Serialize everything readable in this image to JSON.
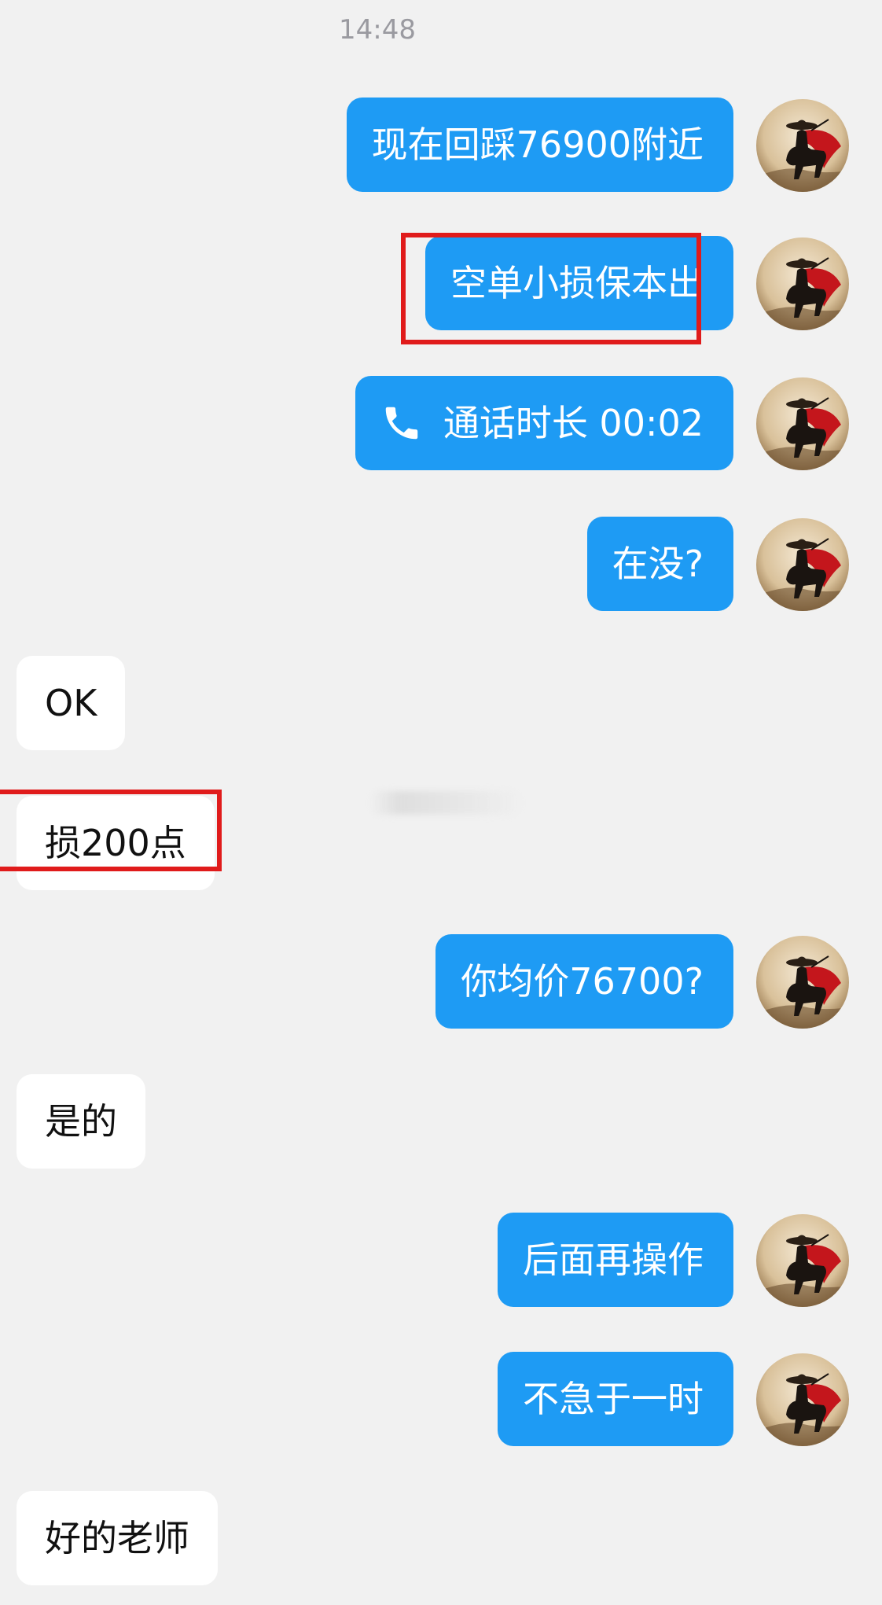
{
  "timestamp": "14:48",
  "messages": [
    {
      "side": "out",
      "text": "现在回踩76900附近"
    },
    {
      "side": "out",
      "text": "空单小损保本出"
    },
    {
      "side": "out",
      "text": "通话时长 00:02",
      "icon": "phone-icon"
    },
    {
      "side": "out",
      "text": "在没?"
    },
    {
      "side": "in",
      "text": "OK"
    },
    {
      "side": "in",
      "text": "损200点"
    },
    {
      "side": "out",
      "text": "你均价76700?"
    },
    {
      "side": "in",
      "text": "是的"
    },
    {
      "side": "out",
      "text": "后面再操作"
    },
    {
      "side": "out",
      "text": "不急于一时"
    },
    {
      "side": "in",
      "text": "好的老师"
    }
  ],
  "colors": {
    "outgoing_bubble": "#1e9bf4",
    "incoming_bubble": "#ffffff",
    "background": "#f1f1f1",
    "highlight_box": "#e01b1b"
  },
  "avatar": {
    "icon": "masked-rider-avatar-icon"
  }
}
